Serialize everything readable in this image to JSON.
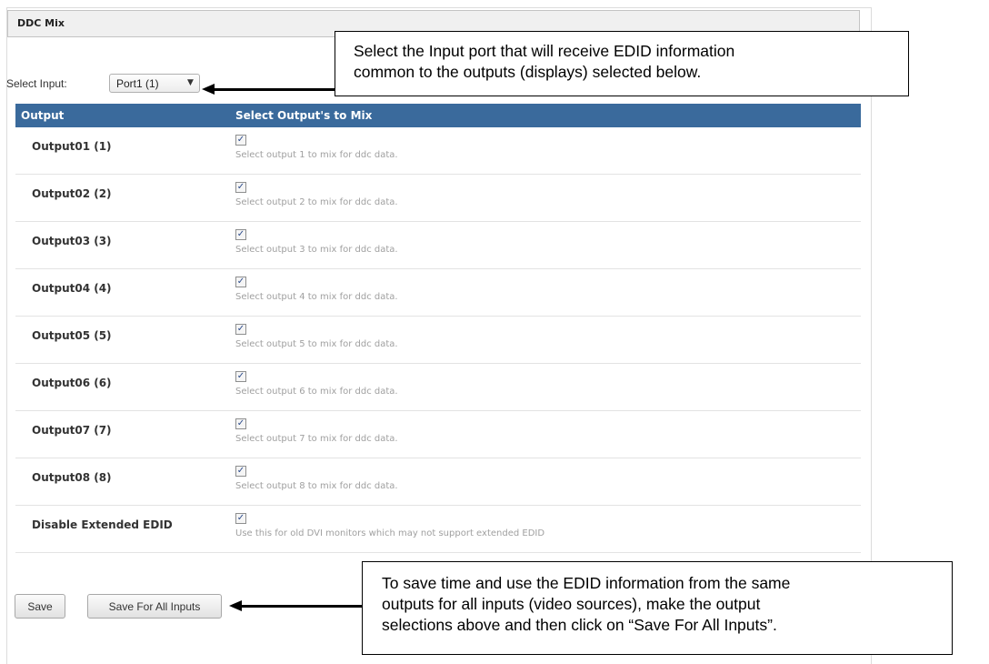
{
  "panel": {
    "title": "DDC Mix"
  },
  "input_select": {
    "label": "Select Input:",
    "value": "Port1 (1)"
  },
  "table": {
    "headers": [
      "Output",
      "Select Output's to Mix"
    ],
    "rows": [
      {
        "name": "Output01 (1)",
        "checked": true,
        "description": "Select output 1 to mix for ddc data."
      },
      {
        "name": "Output02 (2)",
        "checked": true,
        "description": "Select output 2 to mix for ddc data."
      },
      {
        "name": "Output03 (3)",
        "checked": true,
        "description": "Select output 3 to mix for ddc data."
      },
      {
        "name": "Output04 (4)",
        "checked": true,
        "description": "Select output 4 to mix for ddc data."
      },
      {
        "name": "Output05 (5)",
        "checked": true,
        "description": "Select output 5 to mix for ddc data."
      },
      {
        "name": "Output06 (6)",
        "checked": true,
        "description": "Select output 6 to mix for ddc data."
      },
      {
        "name": "Output07 (7)",
        "checked": true,
        "description": "Select output 7 to mix for ddc data."
      },
      {
        "name": "Output08 (8)",
        "checked": true,
        "description": "Select output 8 to mix for ddc data."
      },
      {
        "name": "Disable Extended EDID",
        "checked": true,
        "description": "Use this for old DVI monitors which may not support extended EDID"
      }
    ]
  },
  "buttons": {
    "save": "Save",
    "save_all": "Save For All Inputs"
  },
  "callouts": {
    "top": [
      "Select the Input port that will receive EDID information",
      "common to the outputs (displays) selected below."
    ],
    "bottom": [
      "To save time and use the EDID information from the same",
      "outputs for all inputs (video sources), make the output",
      "selections above and then click on “Save For All Inputs”."
    ]
  },
  "checkbox_glyph": "✓",
  "colors": {
    "header_bg": "#3a6a9c",
    "header_text": "#ffffff"
  }
}
